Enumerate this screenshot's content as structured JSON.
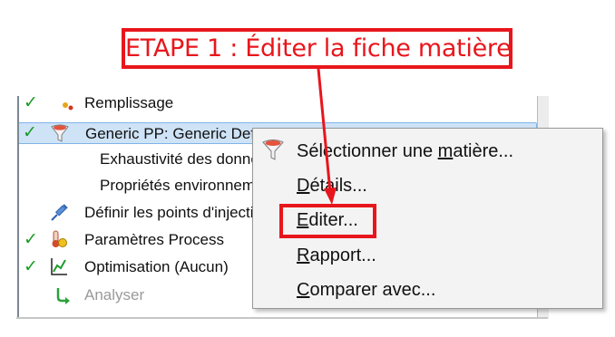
{
  "callout": {
    "text": "ETAPE 1 : Éditer la fiche matière"
  },
  "tree": {
    "items": [
      {
        "label": "Remplissage",
        "checked": true
      },
      {
        "label": "Generic PP: Generic Default",
        "checked": true,
        "selected": true,
        "visible_label": "Generic PP: Generic Default"
      },
      {
        "label": "Exhaustivité des données"
      },
      {
        "label": "Propriétés environnementales"
      },
      {
        "label": "Définir les points d'injection"
      },
      {
        "label": "Paramètres Process",
        "checked": true
      },
      {
        "label": "Optimisation (Aucun)",
        "checked": true
      },
      {
        "label": "Analyser",
        "disabled": true
      }
    ]
  },
  "context_menu": {
    "items": [
      {
        "pre": "Sélectionner une ",
        "accel": "m",
        "post": "atière..."
      },
      {
        "pre": "",
        "accel": "D",
        "post": "étails..."
      },
      {
        "pre": "",
        "accel": "E",
        "post": "diter..."
      },
      {
        "pre": "",
        "accel": "R",
        "post": "apport..."
      },
      {
        "pre": "",
        "accel": "C",
        "post": "omparer avec..."
      }
    ]
  },
  "colors": {
    "accent_red": "#e8161c",
    "check_green": "#1a9a25",
    "selection": "#cfe3f7"
  }
}
